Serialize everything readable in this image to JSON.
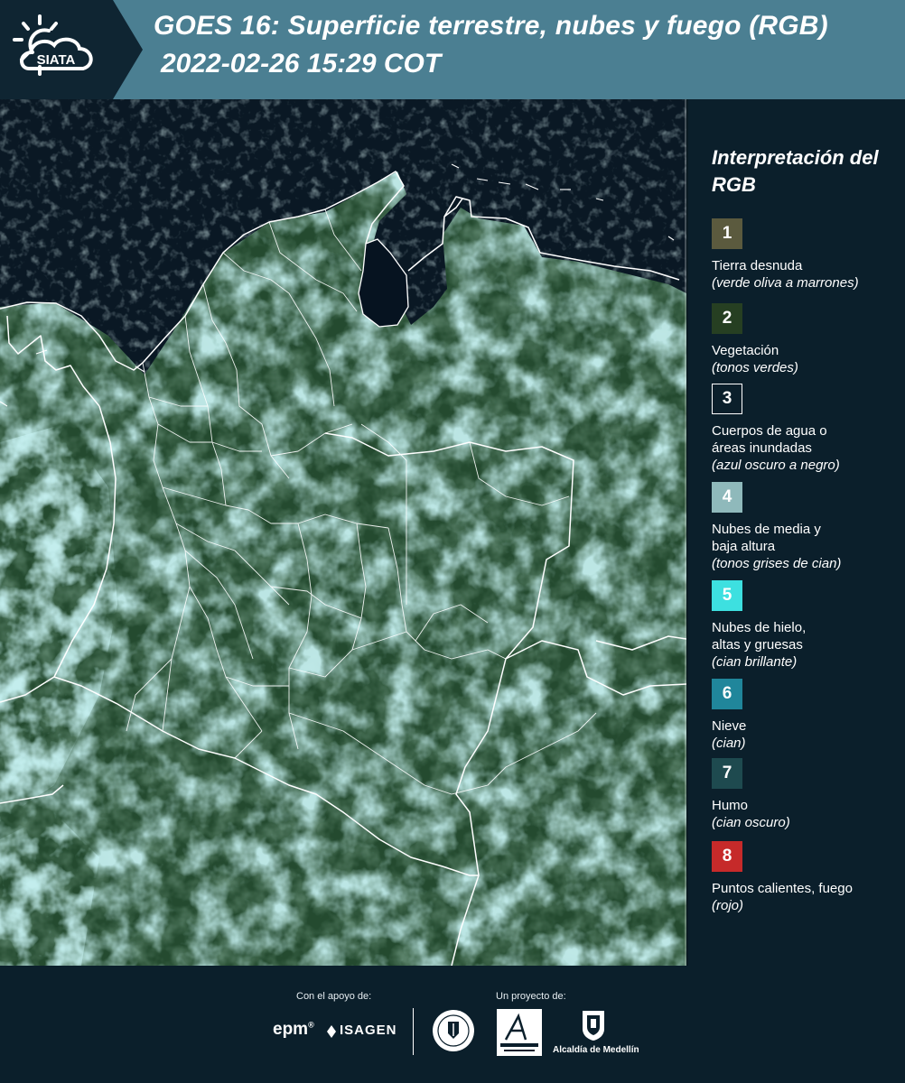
{
  "header": {
    "logo_text": "SIATA",
    "title_line1": "GOES 16: Superficie terrestre, nubes y fuego (RGB)",
    "title_line2": "2022-02-26 15:29 COT"
  },
  "map": {
    "description_icon": "satellite-rgb-map",
    "colors": {
      "vegetation": "#234a2c",
      "cloud_low": "#7fbfbf",
      "cloud_ice": "#9fe6e6",
      "water": "#061320",
      "border": "#ffffff"
    }
  },
  "legend": {
    "title": "Interpretación del RGB",
    "items": [
      {
        "number": "1",
        "label": "Tierra desnuda",
        "sublabel": "(verde oliva a marrones)",
        "color": "#5b5a3e",
        "text_color": "#ffffff"
      },
      {
        "number": "2",
        "label": "Vegetación",
        "sublabel": "(tonos verdes)",
        "color": "#263f22",
        "text_color": "#ffffff"
      },
      {
        "number": "3",
        "label": "Cuerpos de agua o",
        "label2": "áreas inundadas",
        "sublabel": "(azul oscuro a negro)",
        "color": "#0b1f2b",
        "text_color": "#ffffff",
        "border": true
      },
      {
        "number": "4",
        "label": "Nubes de media y",
        "label2": "baja altura",
        "sublabel": "(tonos grises de cian)",
        "color": "#8fb9bb",
        "text_color": "#ffffff"
      },
      {
        "number": "5",
        "label": "Nubes de hielo,",
        "label2": "altas y gruesas",
        "sublabel": "(cian brillante)",
        "color": "#3de0e0",
        "text_color": "#ffffff"
      },
      {
        "number": "6",
        "label": "Nieve",
        "sublabel": "(cian)",
        "color": "#20869b",
        "text_color": "#ffffff"
      },
      {
        "number": "7",
        "label": "Humo",
        "sublabel": "(cian oscuro)",
        "color": "#1e4a4f",
        "text_color": "#ffffff"
      },
      {
        "number": "8",
        "label": "Puntos calientes, fuego",
        "sublabel": "(rojo)",
        "color": "#c62a2a",
        "text_color": "#ffffff"
      }
    ]
  },
  "footer": {
    "support_label": "Con el apoyo de:",
    "project_label": "Un proyecto de:",
    "epm": "epm",
    "isagen": "ISAGEN",
    "alcaldia": "Alcaldía de Medellín"
  }
}
